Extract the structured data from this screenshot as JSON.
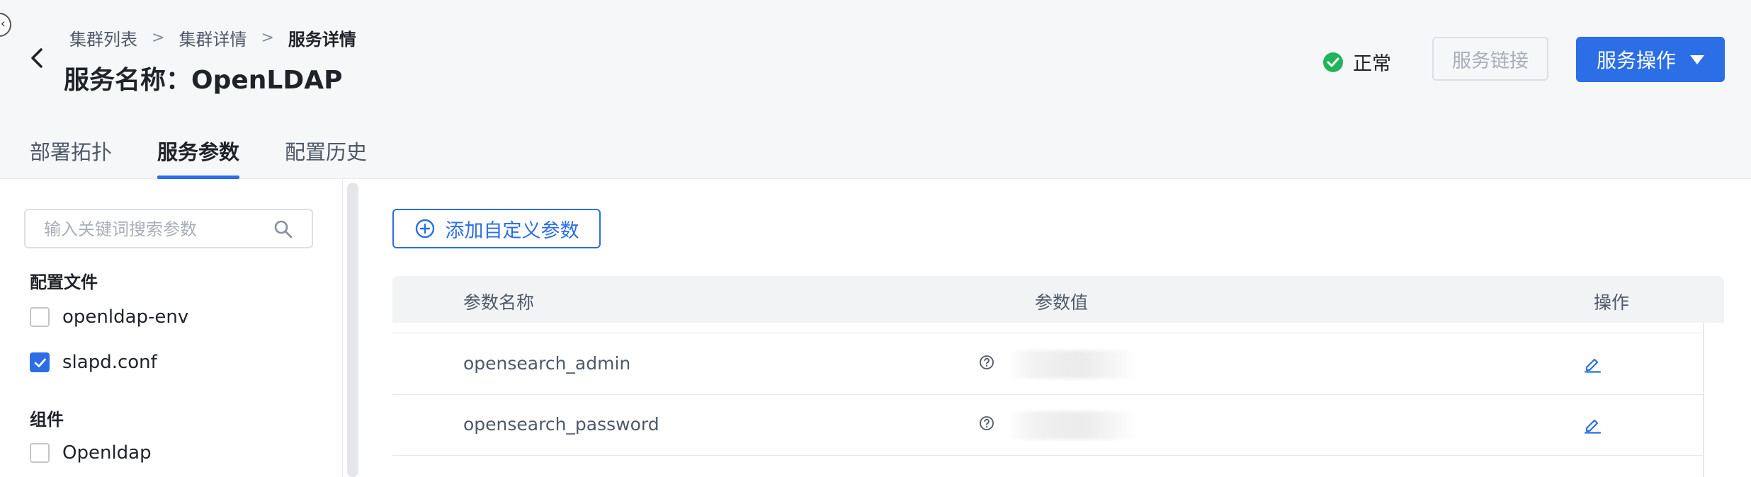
{
  "breadcrumb": [
    "集群列表",
    "集群详情",
    "服务详情"
  ],
  "breadcrumb_separator": ">",
  "page_title": "服务名称：OpenLDAP",
  "status": {
    "text": "正常",
    "color": "#22b45a"
  },
  "buttons": {
    "service_link": "服务链接",
    "service_ops": "服务操作"
  },
  "tabs": [
    {
      "label": "部署拓扑",
      "active": false
    },
    {
      "label": "服务参数",
      "active": true
    },
    {
      "label": "配置历史",
      "active": false
    }
  ],
  "sidebar": {
    "search_placeholder": "输入关键词搜索参数",
    "config_files_title": "配置文件",
    "config_files": [
      {
        "label": "openldap-env",
        "checked": false
      },
      {
        "label": "slapd.conf",
        "checked": true
      }
    ],
    "components_title": "组件",
    "components": [
      {
        "label": "Openldap",
        "checked": false
      }
    ]
  },
  "main": {
    "add_button": "添加自定义参数",
    "table": {
      "headers": {
        "name": "参数名称",
        "value": "参数值",
        "action": "操作"
      },
      "rows": [
        {
          "name": "opensearch_admin",
          "value_masked": true
        },
        {
          "name": "opensearch_password",
          "value_masked": true
        }
      ]
    }
  },
  "colors": {
    "accent": "#2b6ee6",
    "success": "#22b45a",
    "header_bg": "#f6f7f9"
  },
  "icons": [
    "back-arrow-icon",
    "chevron-right-icon",
    "check-circle-icon",
    "caret-down-icon",
    "search-icon",
    "plus-circle-icon",
    "help-circle-icon",
    "edit-icon"
  ]
}
